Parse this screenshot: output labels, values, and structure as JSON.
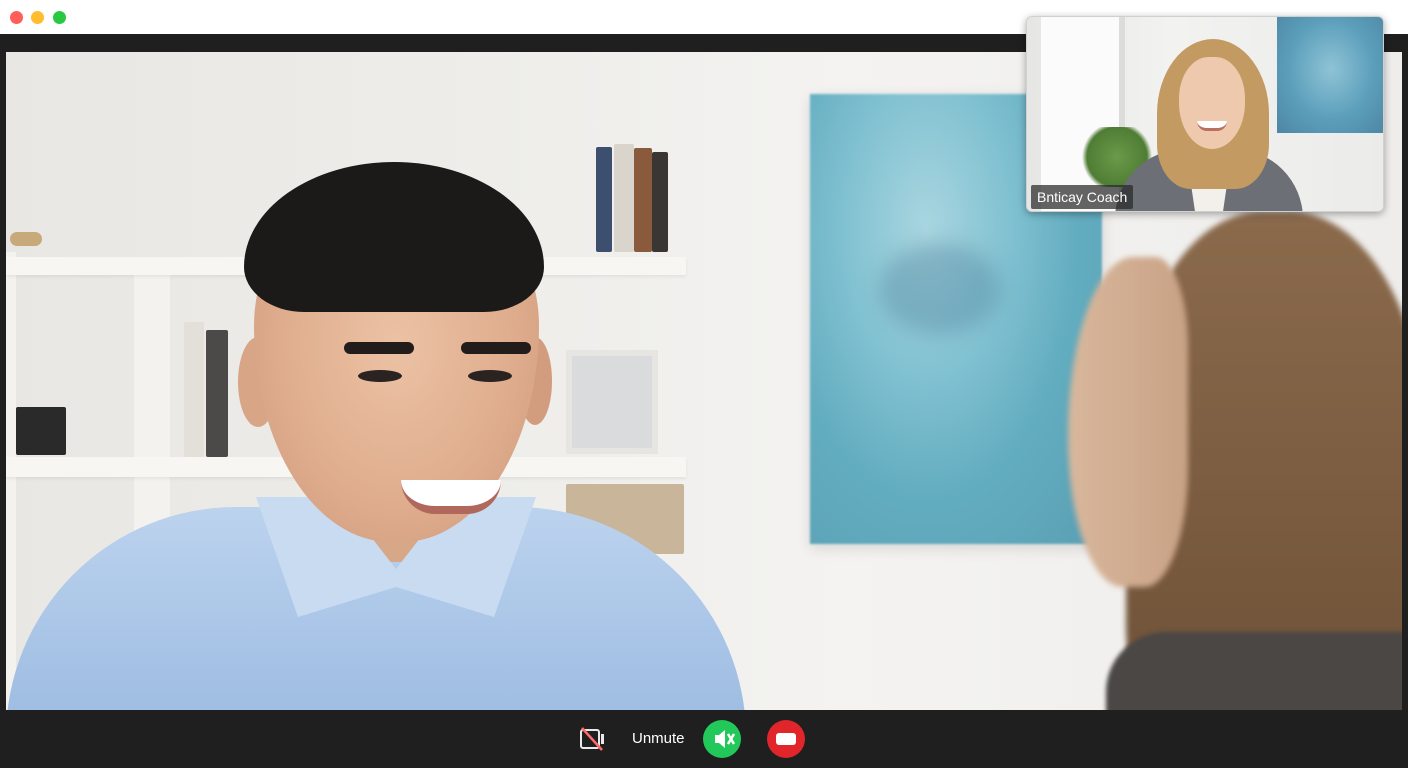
{
  "window": {
    "buttons": [
      "close",
      "minimize",
      "maximize"
    ]
  },
  "pip": {
    "participant_label": "Bnticay Coach"
  },
  "controls": {
    "camera_icon": "camera-off-icon",
    "unmute_label": "Unmute",
    "mic_icon": "mic-muted-icon",
    "end_icon": "end-call-icon"
  },
  "colors": {
    "close": "#ff5f57",
    "minimize": "#febc2e",
    "maximize": "#28c840",
    "mic_button": "#22c95a",
    "end_call_button": "#e0262b",
    "frame": "#1f1f1f"
  }
}
